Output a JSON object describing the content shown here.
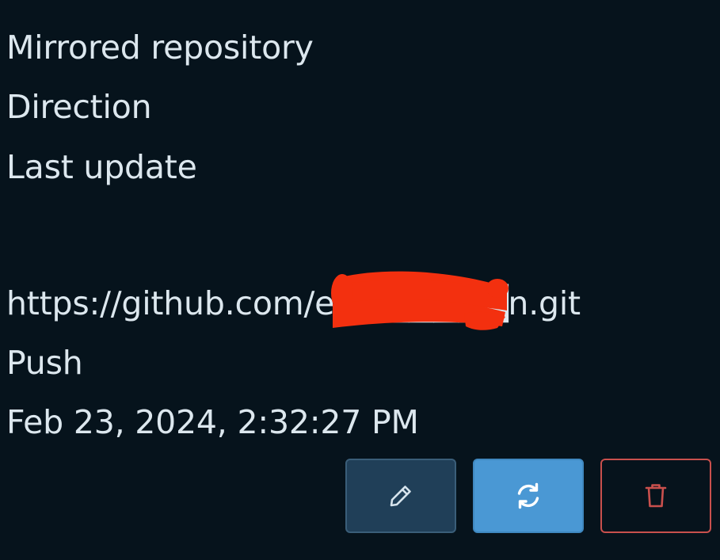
{
  "labels": {
    "mirrored_repository": "Mirrored repository",
    "direction": "Direction",
    "last_update": "Last update"
  },
  "values": {
    "repository_url": "https://github.com/e███████n.git",
    "direction": "Push",
    "last_update": "Feb 23, 2024, 2:32:27 PM"
  },
  "actions": [
    {
      "name": "edit",
      "icon": "pencil-icon"
    },
    {
      "name": "sync",
      "icon": "refresh-icon"
    },
    {
      "name": "delete",
      "icon": "trash-icon"
    }
  ],
  "colors": {
    "background": "#06131c",
    "text": "#dce7ee",
    "edit_button_bg": "#203f58",
    "sync_button_bg": "#4a98d4",
    "delete_accent": "#c9504d",
    "redaction": "#f3300f"
  }
}
